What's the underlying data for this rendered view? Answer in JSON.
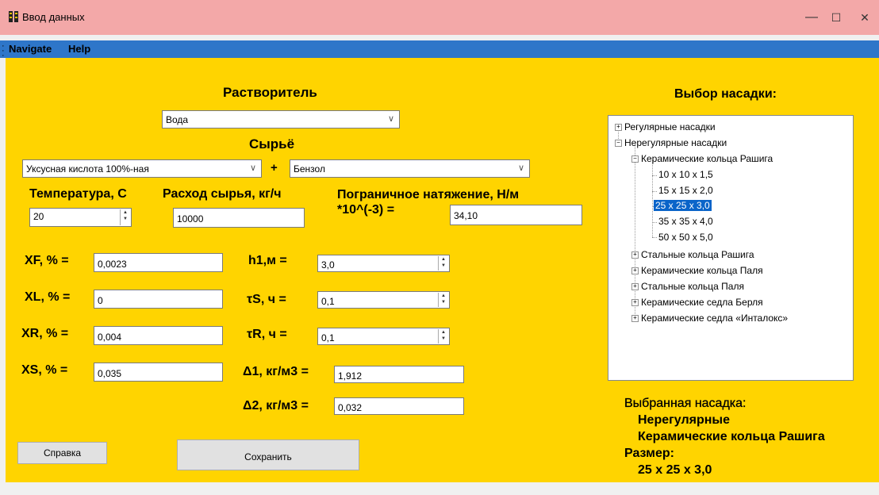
{
  "window": {
    "title": "Ввод данных",
    "minimize": "—",
    "maximize": "☐",
    "close": "✕"
  },
  "menu": {
    "items": [
      "Navigate",
      "Help"
    ]
  },
  "solvent": {
    "label": "Растворитель",
    "value": "Вода"
  },
  "feed": {
    "label": "Сырьё",
    "value1": "Уксусная кислота 100%-ная",
    "plus": "+",
    "value2": "Бензол"
  },
  "temperature": {
    "label": "Температура, С",
    "value": "20"
  },
  "flow": {
    "label": "Расход сырья, кг/ч",
    "value": "10000"
  },
  "tension": {
    "label_line1": "Пограничное натяжение, Н/м",
    "label_line2": "*10^(-3) =",
    "value": "34,10"
  },
  "left_fields": [
    {
      "label": "XF, % =",
      "value": "0,0023"
    },
    {
      "label": "XL, % =",
      "value": "0"
    },
    {
      "label": "XR, % =",
      "value": "0,004"
    },
    {
      "label": "XS, % =",
      "value": "0,035"
    }
  ],
  "mid_fields": [
    {
      "label": "h1,м =",
      "value": "3,0"
    },
    {
      "label": "τS, ч =",
      "value": "0,1"
    },
    {
      "label": "τR, ч =",
      "value": "0,1"
    },
    {
      "label": "Δ1, кг/м3 =",
      "value": "1,912"
    },
    {
      "label": "Δ2, кг/м3 =",
      "value": "0,032"
    }
  ],
  "buttons": {
    "help": "Справка",
    "save": "Сохранить"
  },
  "packing": {
    "title": "Выбор насадки:",
    "tree": {
      "regular": "Регулярные насадки",
      "irregular": "Нерегулярные насадки",
      "raschig_ceramic": "Керамические кольца Рашига",
      "sizes": [
        "10 x 10 x 1,5",
        "15 x 15 x 2,0",
        "25 x 25 x 3,0",
        "35 x 35 x 4,0",
        "50 x 50 x 5,0"
      ],
      "others": [
        "Стальные кольца Рашига",
        "Керамические кольца Паля",
        "Стальные кольца Паля",
        "Керамические седла Берля",
        "Керамические седла «Инталокс»"
      ]
    },
    "selected_title": "Выбранная насадка:",
    "selected_type": "Нерегулярные",
    "selected_name": "Керамические кольца Рашига",
    "size_label": "Размер:",
    "size_value": "25 x 25 x 3,0"
  }
}
